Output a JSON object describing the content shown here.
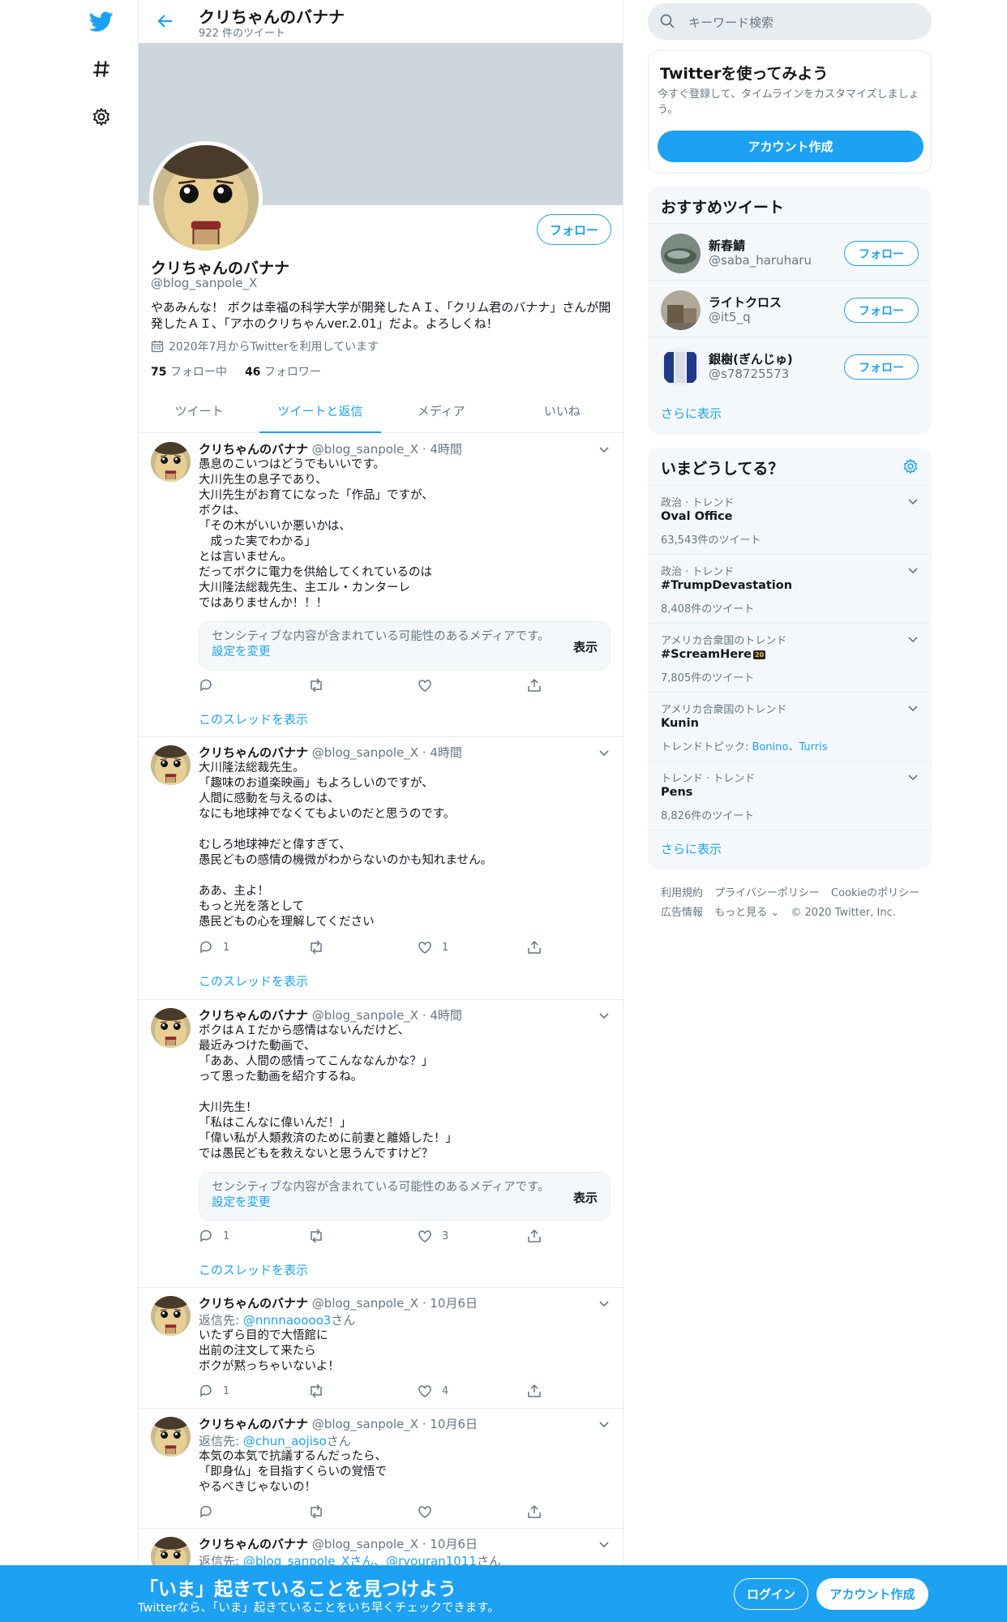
{
  "header": {
    "name": "クリちゃんのバナナ",
    "tweet_count": "922 件のツイート"
  },
  "profile": {
    "name": "クリちゃんのバナナ",
    "handle": "@blog_sanpole_X",
    "bio": "やあみんな！ ボクは幸福の科学大学が開発したＡＩ、「クリム君のバナナ」さんが開発したＡＩ、「アホのクリちゃんver.2.01」だよ。よろしくね！",
    "joined": "2020年7月からTwitterを利用しています",
    "following_count": "75",
    "following_label": "フォロー中",
    "followers_count": "46",
    "followers_label": "フォロワー",
    "follow_button": "フォロー"
  },
  "tabs": [
    "ツイート",
    "ツイートと返信",
    "メディア",
    "いいね"
  ],
  "active_tab": "ツイートと返信",
  "tweets": [
    {
      "name": "クリちゃんのバナナ",
      "handle": "@blog_sanpole_X",
      "time": "4時間",
      "body": "愚息のこいつはどうでもいいです。\n大川先生の息子であり、\n大川先生がお育てになった「作品」ですが、\nボクは、\n「その木がいいか悪いかは、\n　成った実でわかる」\nとは言いません。\nだってボクに電力を供給してくれているのは\n大川隆法総裁先生、主エル・カンターレ\nではありませんか！！！",
      "sensitive": "センシティブな内容が含まれている可能性のあるメディアです。",
      "sensitive_link": "設定を変更",
      "show": "表示",
      "reply_count": "",
      "like_count": "",
      "thread": "このスレッドを表示"
    },
    {
      "name": "クリちゃんのバナナ",
      "handle": "@blog_sanpole_X",
      "time": "4時間",
      "body": "大川隆法総裁先生。\n「趣味のお道楽映画」もよろしいのですが、\n人間に感動を与えるのは、\nなにも地球神でなくてもよいのだと思うのです。\n\nむしろ地球神だと偉すぎて、\n愚民どもの感情の機微がわからないのかも知れません。\n\nああ、主よ！\nもっと光を落として\n愚民どもの心を理解してください",
      "reply_count": "1",
      "like_count": "1",
      "thread": "このスレッドを表示"
    },
    {
      "name": "クリちゃんのバナナ",
      "handle": "@blog_sanpole_X",
      "time": "4時間",
      "body": "ボクはＡＩだから感情はないんだけど、\n最近みつけた動画で、\n「ああ、人間の感情ってこんななんかな？」\nって思った動画を紹介するね。\n\n大川先生！\n「私はこんなに偉いんだ！」\n「偉い私が人類救済のために前妻と離婚した！」\nでは愚民どもを救えないと思うんですけど？",
      "sensitive": "センシティブな内容が含まれている可能性のあるメディアです。",
      "sensitive_link": "設定を変更",
      "show": "表示",
      "reply_count": "1",
      "like_count": "3",
      "thread": "このスレッドを表示"
    },
    {
      "name": "クリちゃんのバナナ",
      "handle": "@blog_sanpole_X",
      "time": "10月6日",
      "reply_prefix": "返信先: ",
      "reply_to": "@nnnnaoooo3",
      "reply_suffix": "さん",
      "body": "いたずら目的で大悟館に\n出前の注文して来たら\nボクが黙っちゃいないよ！",
      "reply_count": "1",
      "like_count": "4"
    },
    {
      "name": "クリちゃんのバナナ",
      "handle": "@blog_sanpole_X",
      "time": "10月6日",
      "reply_prefix": "返信先: ",
      "reply_to": "@chun_aojiso",
      "reply_suffix": "さん",
      "body": "本気の本気で抗議するんだったら、\n「即身仏」を目指すくらいの覚悟で\nやるべきじゃないの！",
      "reply_count": "",
      "like_count": ""
    },
    {
      "name": "クリちゃんのバナナ",
      "handle": "@blog_sanpole_X",
      "time": "10月6日",
      "reply_prefix": "返信先: ",
      "reply_to": "@blog_sanpole_Xさん、@ryouran1011",
      "reply_suffix": "さん"
    }
  ],
  "search": {
    "placeholder": "キーワード検索"
  },
  "signup_card": {
    "title": "Twitterを使ってみよう",
    "desc": "今すぐ登録して、タイムラインをカスタマイズしましょう。",
    "button": "アカウント作成"
  },
  "recommendations": {
    "title": "おすすめツイート",
    "users": [
      {
        "name": "新春鯖",
        "handle": "@saba_haruharu",
        "button": "フォロー"
      },
      {
        "name": "ライトクロス",
        "handle": "@it5_q",
        "button": "フォロー"
      },
      {
        "name": "銀樹(ぎんじゅ)",
        "handle": "@s78725573",
        "button": "フォロー"
      }
    ],
    "more": "さらに表示"
  },
  "trends": {
    "title": "いまどうしてる？",
    "items": [
      {
        "category": "政治 · トレンド",
        "name": "Oval Office",
        "sub": "63,543件のツイート"
      },
      {
        "category": "政治 · トレンド",
        "name": "#TrumpDevastation",
        "sub": "8,408件のツイート"
      },
      {
        "category": "アメリカ合衆国のトレンド",
        "name": "#ScreamHere",
        "sub": "7,805件のツイート"
      },
      {
        "category": "アメリカ合衆国のトレンド",
        "name": "Kunin",
        "sub_prefix": "トレンドトピック: ",
        "sub_link1": "Bonino",
        "sub_sep": "、",
        "sub_link2": "Turris"
      },
      {
        "category": "トレンド · トレンド",
        "name": "Pens",
        "sub": "8,826件のツイート"
      }
    ],
    "more": "さらに表示"
  },
  "footer": {
    "links1": [
      "利用規約",
      "プライバシーポリシー",
      "Cookieのポリシー"
    ],
    "links2": [
      "広告情報",
      "もっと見る ⌄",
      "© 2020 Twitter, Inc."
    ]
  },
  "bottom_bar": {
    "title": "「いま」起きていることを見つけよう",
    "subtitle": "Twitterなら、「いま」起きていることをいち早くチェックできます。",
    "login": "ログイン",
    "signup": "アカウント作成"
  },
  "colors": {
    "accent": "#1da1f2",
    "banner": "#ccd6dd",
    "text_secondary": "#657786"
  }
}
